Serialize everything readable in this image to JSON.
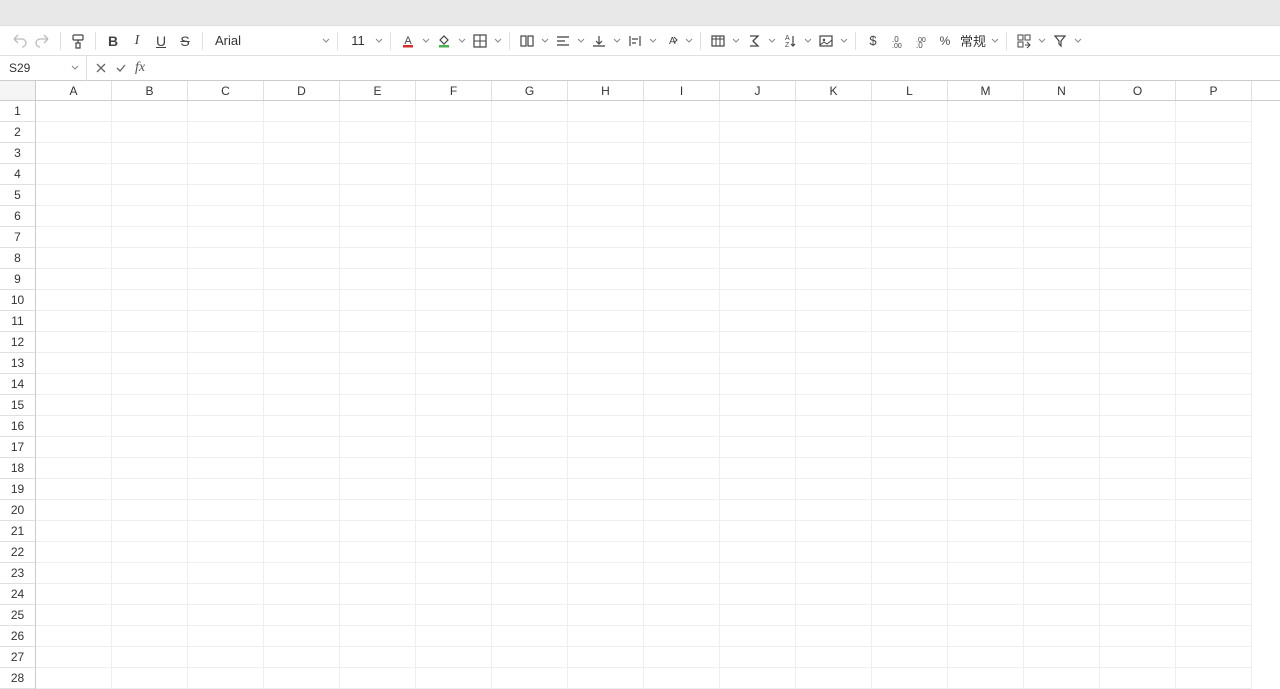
{
  "name_box": "S29",
  "font_name": "Arial",
  "font_size": "11",
  "number_format_label": "常规",
  "columns": [
    "A",
    "B",
    "C",
    "D",
    "E",
    "F",
    "G",
    "H",
    "I",
    "J",
    "K",
    "L",
    "M",
    "N",
    "O",
    "P"
  ],
  "rows": [
    "1",
    "2",
    "3",
    "4",
    "5",
    "6",
    "7",
    "8",
    "9",
    "10",
    "11",
    "12",
    "13",
    "14",
    "15",
    "16",
    "17",
    "18",
    "19",
    "20",
    "21",
    "22",
    "23",
    "24",
    "25",
    "26",
    "27",
    "28"
  ],
  "formula_value": "",
  "icons": {
    "undo": "undo-icon",
    "redo": "redo-icon",
    "format_painter": "format-painter-icon",
    "bold": "B",
    "italic": "I",
    "underline": "U",
    "strike": "S"
  }
}
